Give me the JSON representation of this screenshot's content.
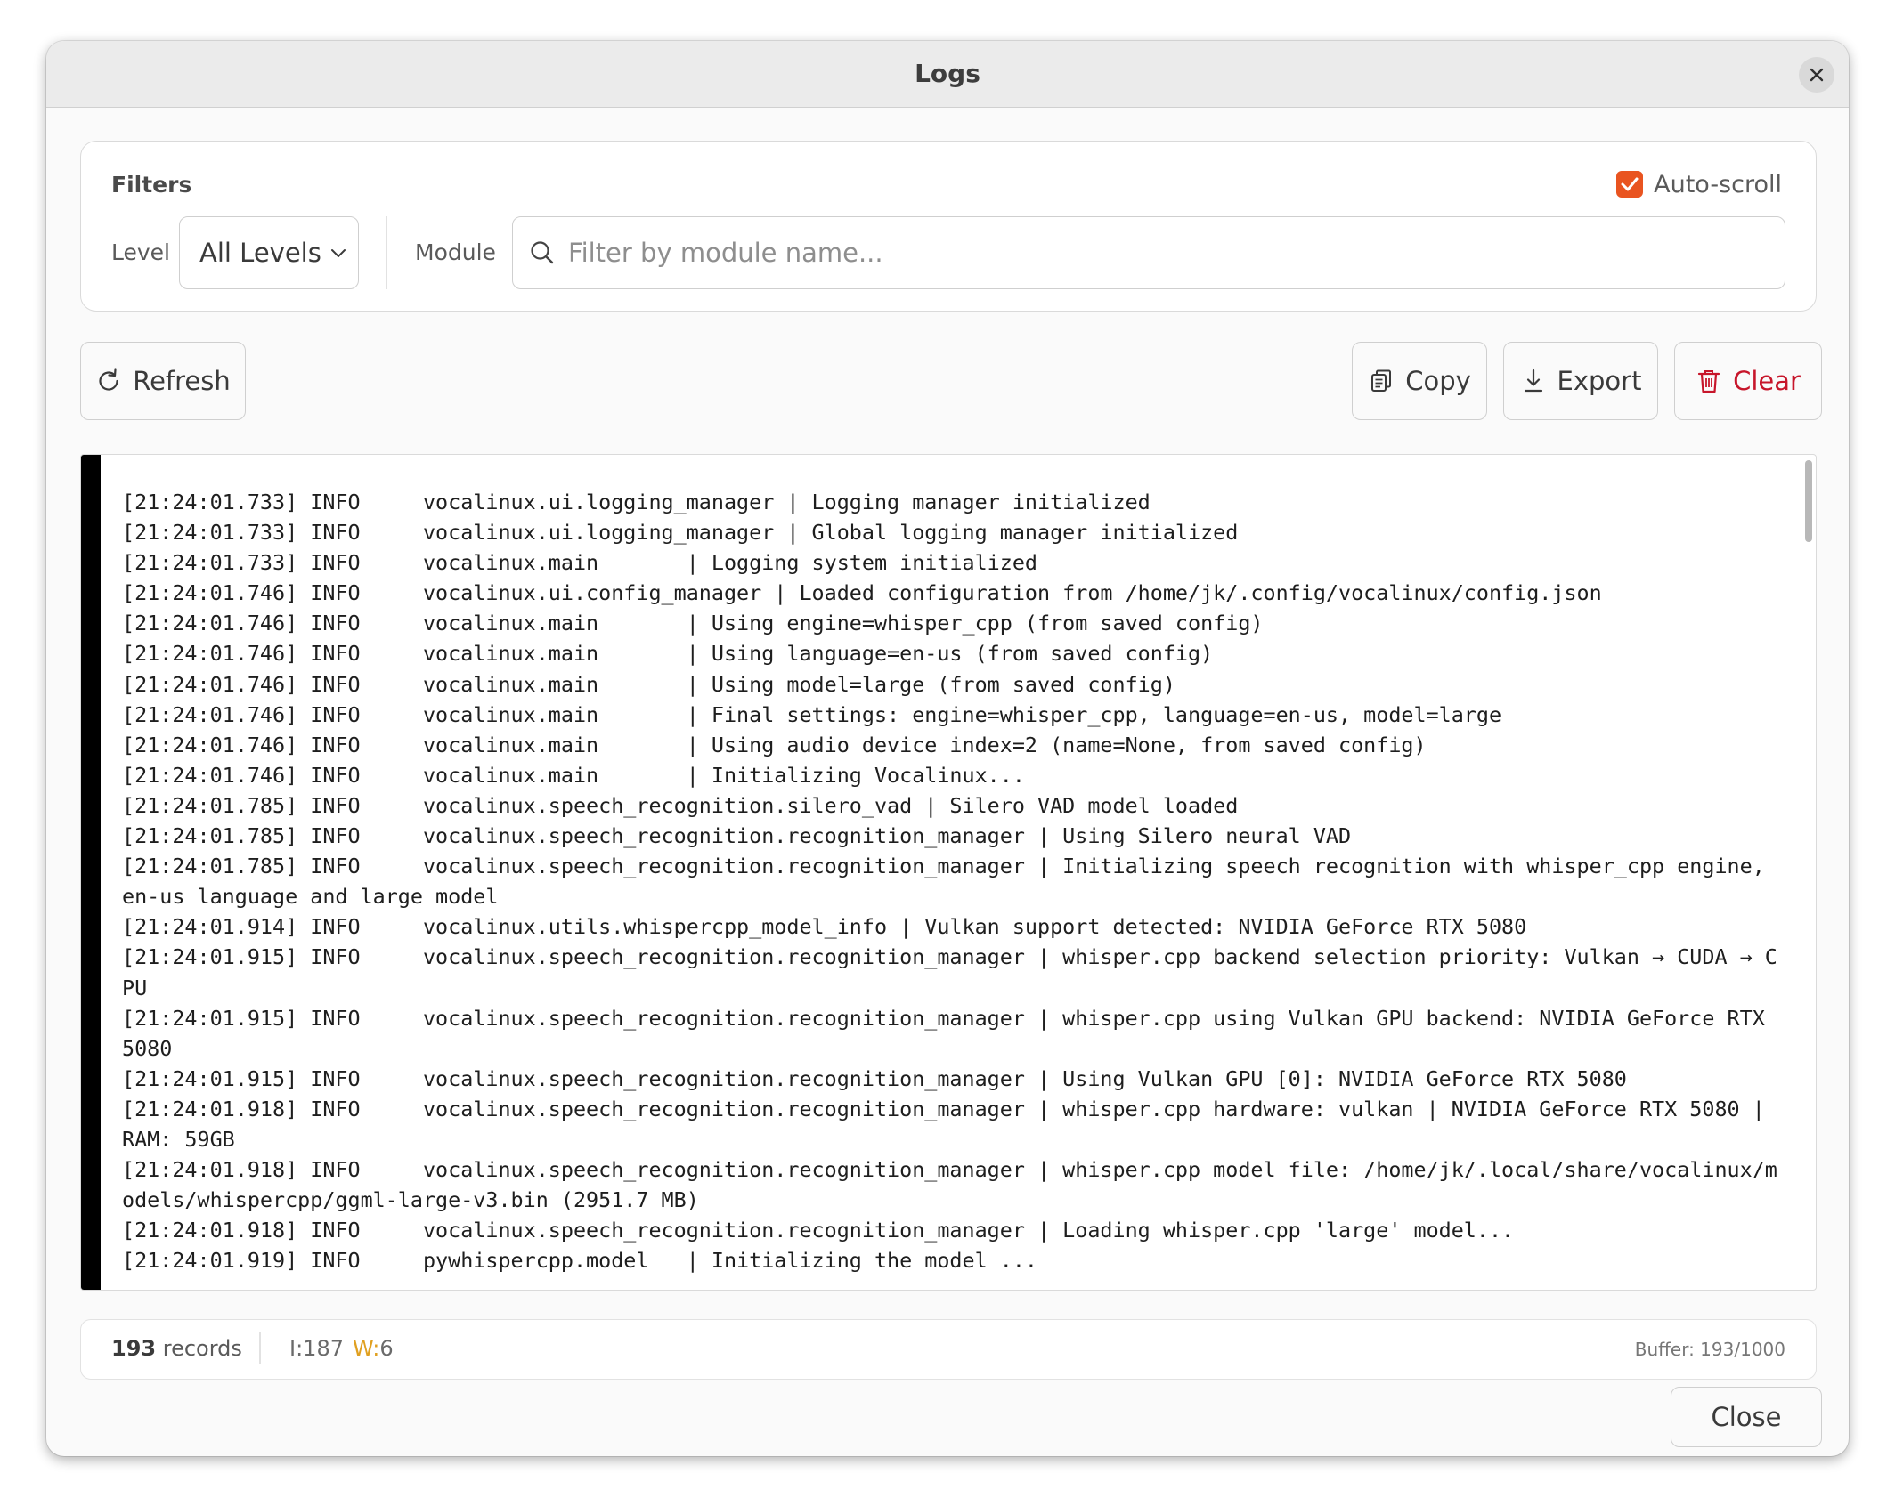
{
  "window": {
    "title": "Logs"
  },
  "filters": {
    "label": "Filters",
    "auto_scroll_label": "Auto-scroll",
    "auto_scroll_checked": true,
    "level_label": "Level",
    "level_value": "All Levels",
    "module_label": "Module",
    "module_placeholder": "Filter by module name..."
  },
  "toolbar": {
    "refresh_label": "Refresh",
    "copy_label": "Copy",
    "export_label": "Export",
    "clear_label": "Clear"
  },
  "log_lines": [
    "[21:24:01.733] INFO     vocalinux.ui.logging_manager | Logging manager initialized",
    "[21:24:01.733] INFO     vocalinux.ui.logging_manager | Global logging manager initialized",
    "[21:24:01.733] INFO     vocalinux.main       | Logging system initialized",
    "[21:24:01.746] INFO     vocalinux.ui.config_manager | Loaded configuration from /home/jk/.config/vocalinux/config.json",
    "[21:24:01.746] INFO     vocalinux.main       | Using engine=whisper_cpp (from saved config)",
    "[21:24:01.746] INFO     vocalinux.main       | Using language=en-us (from saved config)",
    "[21:24:01.746] INFO     vocalinux.main       | Using model=large (from saved config)",
    "[21:24:01.746] INFO     vocalinux.main       | Final settings: engine=whisper_cpp, language=en-us, model=large",
    "[21:24:01.746] INFO     vocalinux.main       | Using audio device index=2 (name=None, from saved config)",
    "[21:24:01.746] INFO     vocalinux.main       | Initializing Vocalinux...",
    "[21:24:01.785] INFO     vocalinux.speech_recognition.silero_vad | Silero VAD model loaded",
    "[21:24:01.785] INFO     vocalinux.speech_recognition.recognition_manager | Using Silero neural VAD",
    "[21:24:01.785] INFO     vocalinux.speech_recognition.recognition_manager | Initializing speech recognition with whisper_cpp engine, en-us language and large model",
    "[21:24:01.914] INFO     vocalinux.utils.whispercpp_model_info | Vulkan support detected: NVIDIA GeForce RTX 5080",
    "[21:24:01.915] INFO     vocalinux.speech_recognition.recognition_manager | whisper.cpp backend selection priority: Vulkan → CUDA → CPU",
    "[21:24:01.915] INFO     vocalinux.speech_recognition.recognition_manager | whisper.cpp using Vulkan GPU backend: NVIDIA GeForce RTX 5080",
    "[21:24:01.915] INFO     vocalinux.speech_recognition.recognition_manager | Using Vulkan GPU [0]: NVIDIA GeForce RTX 5080",
    "[21:24:01.918] INFO     vocalinux.speech_recognition.recognition_manager | whisper.cpp hardware: vulkan | NVIDIA GeForce RTX 5080 | RAM: 59GB",
    "[21:24:01.918] INFO     vocalinux.speech_recognition.recognition_manager | whisper.cpp model file: /home/jk/.local/share/vocalinux/models/whispercpp/ggml-large-v3.bin (2951.7 MB)",
    "[21:24:01.918] INFO     vocalinux.speech_recognition.recognition_manager | Loading whisper.cpp 'large' model...",
    "[21:24:01.919] INFO     pywhispercpp.model   | Initializing the model ..."
  ],
  "status": {
    "record_count": "193",
    "records_label": "records",
    "info_label": "I:",
    "info_count": "187",
    "warn_label": "W:",
    "warn_count": "6",
    "buffer": "Buffer: 193/1000"
  },
  "footer": {
    "close_label": "Close"
  },
  "colors": {
    "accent": "#e95420",
    "clear_red": "#c7162b",
    "warning": "#e0a020",
    "log_gutter": "#000000"
  },
  "icons": [
    "close-icon",
    "checkmark-icon",
    "chevron-down-icon",
    "search-icon",
    "refresh-icon",
    "copy-icon",
    "download-icon",
    "trash-icon"
  ]
}
